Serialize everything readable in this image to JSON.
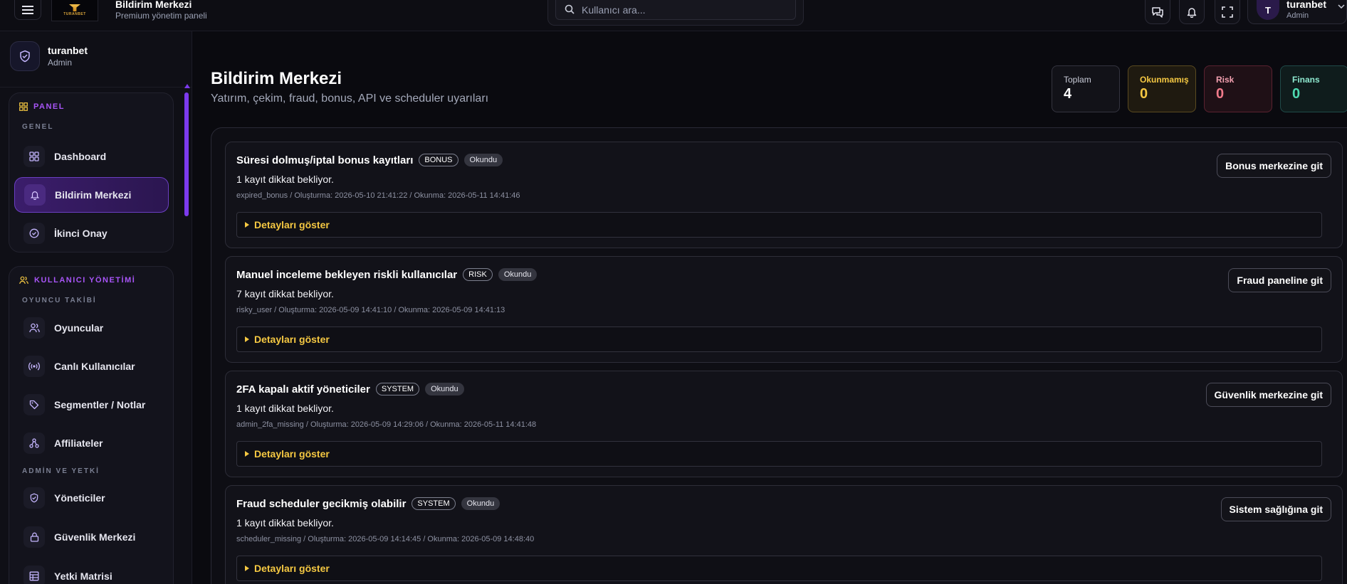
{
  "topbar": {
    "brand_title": "Bildirim Merkezi",
    "brand_subtitle": "Premium yönetim paneli",
    "logo_text": "TURANBET",
    "search_placeholder": "Kullanıcı ara...",
    "user": {
      "initial": "T",
      "name": "turanbet",
      "role": "Admin"
    }
  },
  "sidebar": {
    "profile": {
      "name": "turanbet",
      "role": "Admin"
    },
    "groups": [
      {
        "title": "PANEL",
        "sections": [
          {
            "label": "GENEL",
            "items": [
              {
                "label": "Dashboard",
                "icon": "grid-icon",
                "active": false
              },
              {
                "label": "Bildirim Merkezi",
                "icon": "bell-icon",
                "active": true
              },
              {
                "label": "İkinci Onay",
                "icon": "check-circle-icon",
                "active": false
              }
            ]
          }
        ]
      },
      {
        "title": "KULLANICI YÖNETİMİ",
        "sections": [
          {
            "label": "OYUNCU TAKİBİ",
            "items": [
              {
                "label": "Oyuncular",
                "icon": "users-icon"
              },
              {
                "label": "Canlı Kullanıcılar",
                "icon": "broadcast-icon"
              },
              {
                "label": "Segmentler / Notlar",
                "icon": "tag-icon"
              },
              {
                "label": "Affiliateler",
                "icon": "network-icon"
              }
            ]
          },
          {
            "label": "ADMİN VE YETKİ",
            "items": [
              {
                "label": "Yöneticiler",
                "icon": "shield-check-icon"
              },
              {
                "label": "Güvenlik Merkezi",
                "icon": "lock-icon"
              },
              {
                "label": "Yetki Matrisi",
                "icon": "table-icon"
              }
            ]
          }
        ]
      }
    ]
  },
  "main": {
    "title": "Bildirim Merkezi",
    "subtitle": "Yatırım, çekim, fraud, bonus, API ve scheduler uyarıları",
    "stats": [
      {
        "label": "Toplam",
        "value": "4",
        "color": "#ffffff"
      },
      {
        "label": "Okunmamış",
        "value": "0",
        "color": "#f5c842"
      },
      {
        "label": "Risk",
        "value": "0",
        "color": "#f07a8a"
      },
      {
        "label": "Finans",
        "value": "0",
        "color": "#4ed8b0"
      }
    ],
    "notifications": [
      {
        "title": "Süresi dolmuş/iptal bonus kayıtları",
        "tag": "BONUS",
        "status": "Okundu",
        "count_text": "1 kayıt dikkat bekliyor.",
        "meta": "expired_bonus / Oluşturma: 2026-05-10 21:41:22 / Okunma: 2026-05-11 14:41:46",
        "action": "Bonus merkezine git",
        "details": "Detayları göster"
      },
      {
        "title": "Manuel inceleme bekleyen riskli kullanıcılar",
        "tag": "RISK",
        "status": "Okundu",
        "count_text": "7 kayıt dikkat bekliyor.",
        "meta": "risky_user / Oluşturma: 2026-05-09 14:41:10 / Okunma: 2026-05-09 14:41:13",
        "action": "Fraud paneline git",
        "details": "Detayları göster"
      },
      {
        "title": "2FA kapalı aktif yöneticiler",
        "tag": "SYSTEM",
        "status": "Okundu",
        "count_text": "1 kayıt dikkat bekliyor.",
        "meta": "admin_2fa_missing / Oluşturma: 2026-05-09 14:29:06 / Okunma: 2026-05-11 14:41:48",
        "action": "Güvenlik merkezine git",
        "details": "Detayları göster"
      },
      {
        "title": "Fraud scheduler gecikmiş olabilir",
        "tag": "SYSTEM",
        "status": "Okundu",
        "count_text": "1 kayıt dikkat bekliyor.",
        "meta": "scheduler_missing / Oluşturma: 2026-05-09 14:14:45 / Okunma: 2026-05-09 14:48:40",
        "action": "Sistem sağlığına git",
        "details": "Detayları göster"
      }
    ]
  }
}
